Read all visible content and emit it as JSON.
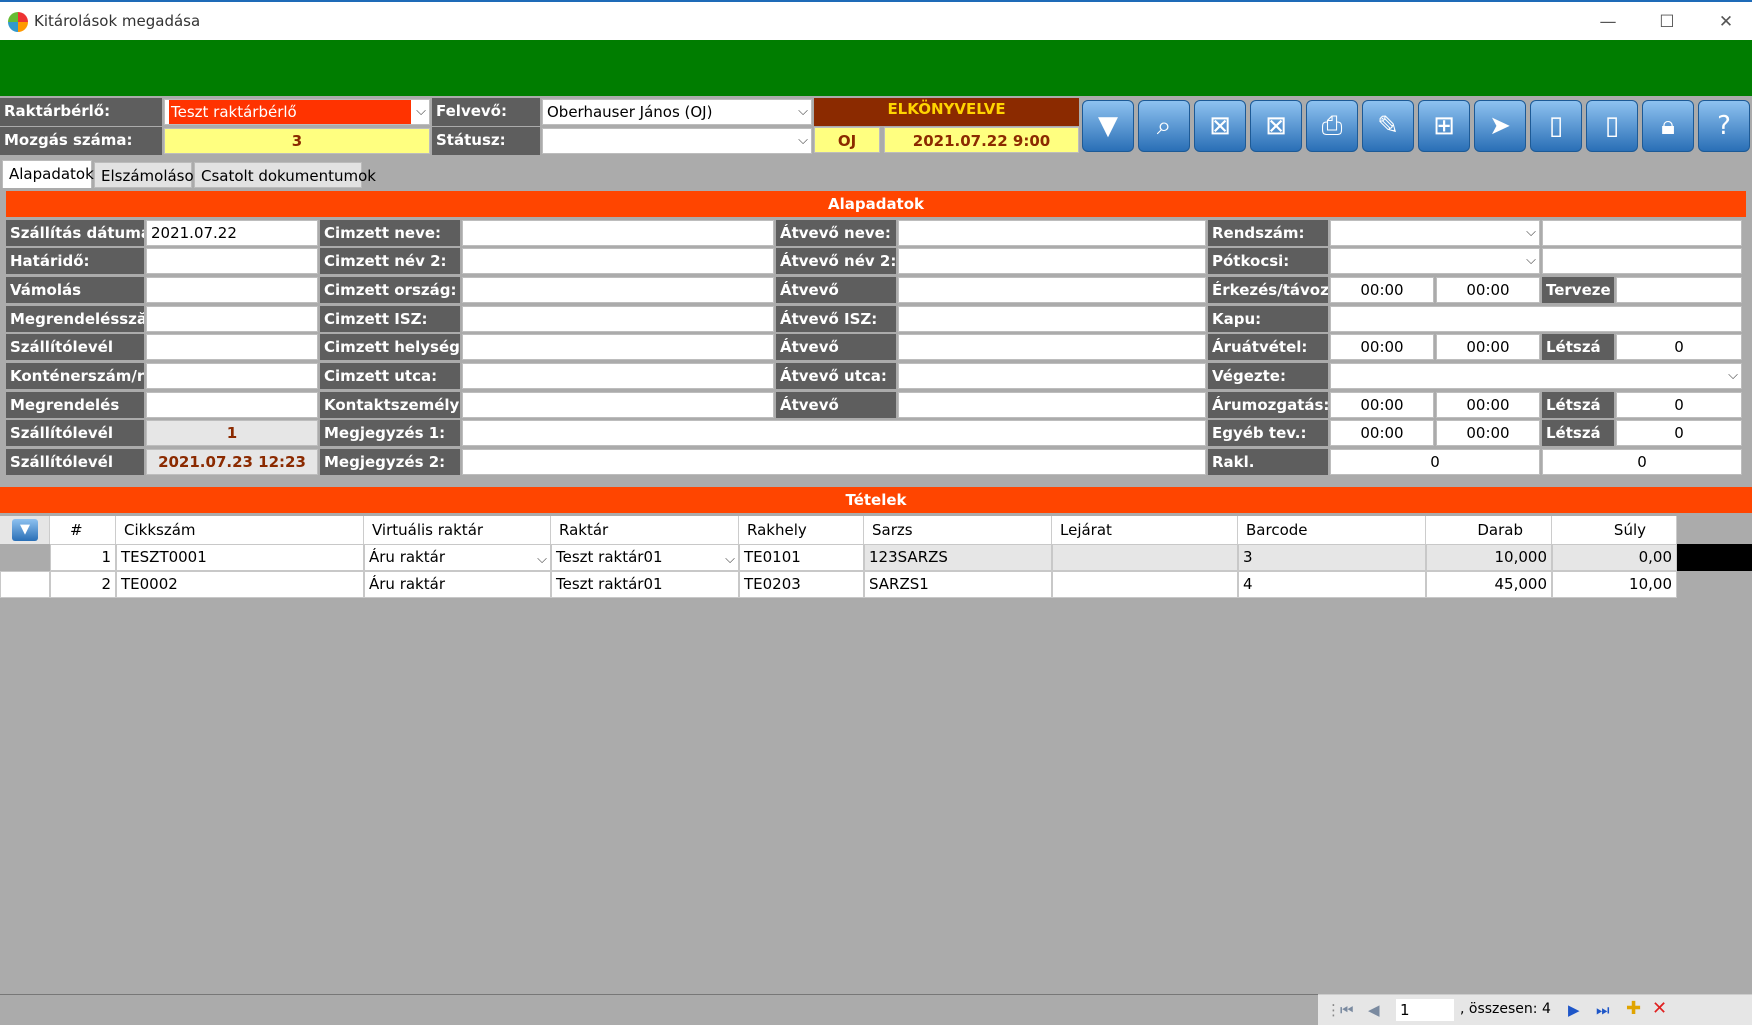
{
  "window": {
    "title": "Kitárolások megadása",
    "minimize": "—",
    "maximize": "☐",
    "close": "✕"
  },
  "header": {
    "tenant_label": "Raktárbérlő:",
    "tenant_value": "Teszt raktárbérlő",
    "recorder_label": "Felvevő:",
    "recorder_value": "Oberhauser János (OJ)",
    "movement_label": "Mozgás száma:",
    "movement_value": "3",
    "status_label": "Státusz:",
    "status_value": "",
    "state": "ELKÖNYVELVE",
    "user_code": "OJ",
    "datetime": "2021.07.22 9:00"
  },
  "toolbar": [
    "filter-icon",
    "search-icon",
    "excel-import-icon",
    "excel-export-icon",
    "print-icon",
    "attach-icon",
    "new-document-icon",
    "send-icon",
    "mobile-download-icon",
    "mobile-upload-icon",
    "lock-icon",
    "help-icon"
  ],
  "tabs": [
    "Alapadatok",
    "Elszámolások",
    "Csatolt dokumentumok"
  ],
  "section_title": "Alapadatok",
  "col1": [
    {
      "label": "Szállítás dátuma:",
      "value": "2021.07.22"
    },
    {
      "label": "Határidő:",
      "value": ""
    },
    {
      "label": "Vámolás",
      "value": ""
    },
    {
      "label": "Megrendeléssză",
      "value": ""
    },
    {
      "label": "Szállítólevél",
      "value": ""
    },
    {
      "label": "Konténerszám/r",
      "value": ""
    },
    {
      "label": "Megrendelés",
      "value": ""
    },
    {
      "label": "Szállítólevél",
      "value": "1"
    },
    {
      "label": "Szállítólevél",
      "value": "2021.07.23 12:23"
    }
  ],
  "col2": [
    {
      "label": "Cimzett neve:",
      "value": ""
    },
    {
      "label": "Cimzett név 2:",
      "value": ""
    },
    {
      "label": "Cimzett ország:",
      "value": ""
    },
    {
      "label": "Cimzett ISZ:",
      "value": ""
    },
    {
      "label": "Cimzett helység:",
      "value": ""
    },
    {
      "label": "Cimzett utca:",
      "value": ""
    },
    {
      "label": "Kontaktszemély:",
      "value": ""
    },
    {
      "label": "Megjegyzés 1:",
      "value": ""
    },
    {
      "label": "Megjegyzés 2:",
      "value": ""
    }
  ],
  "col3": [
    {
      "label": "Átvevő neve:",
      "value": ""
    },
    {
      "label": "Átvevő név 2:",
      "value": ""
    },
    {
      "label": "Átvevő",
      "value": ""
    },
    {
      "label": "Átvevő ISZ:",
      "value": ""
    },
    {
      "label": "Átvevő",
      "value": ""
    },
    {
      "label": "Átvevő utca:",
      "value": ""
    },
    {
      "label": "Átvevő",
      "value": ""
    }
  ],
  "col4": {
    "plate_label": "Rendszám:",
    "trailer_label": "Pótkocsi:",
    "arrival_label": "Érkezés/távoz",
    "arrival_from": "00:00",
    "arrival_to": "00:00",
    "planned_label": "Terveze",
    "gate_label": "Kapu:",
    "receipt_label": "Áruátvétel:",
    "receipt_from": "00:00",
    "receipt_to": "00:00",
    "receipt_head_label": "Létszá",
    "receipt_head": "0",
    "done_label": "Végezte:",
    "moving_label": "Árumozgatás:",
    "moving_from": "00:00",
    "moving_to": "00:00",
    "moving_head_label": "Létszá",
    "moving_head": "0",
    "other_label": "Egyéb tev.:",
    "other_from": "00:00",
    "other_to": "00:00",
    "other_head_label": "Létszá",
    "other_head": "0",
    "rakl_label": "Rakl.",
    "rakl_1": "0",
    "rakl_2": "0"
  },
  "items_title": "Tételek",
  "grid": {
    "headers": [
      "#",
      "Cikkszám",
      "Virtuális raktár",
      "Raktár",
      "Rakhely",
      "Sarzs",
      "Lejárat",
      "Barcode",
      "Darab",
      "Súly"
    ],
    "rows": [
      [
        "1",
        "TESZT0001",
        "Áru raktár",
        "Teszt raktár01",
        "TE0101",
        "123SARZS",
        "",
        "3",
        "10,000",
        "0,00"
      ],
      [
        "2",
        "TE0002",
        "Áru raktár",
        "Teszt raktár01",
        "TE0203",
        "SARZS1",
        "",
        "4",
        "45,000",
        "10,00"
      ]
    ]
  },
  "nav": {
    "page": "1",
    "total": ", összesen: 4"
  }
}
